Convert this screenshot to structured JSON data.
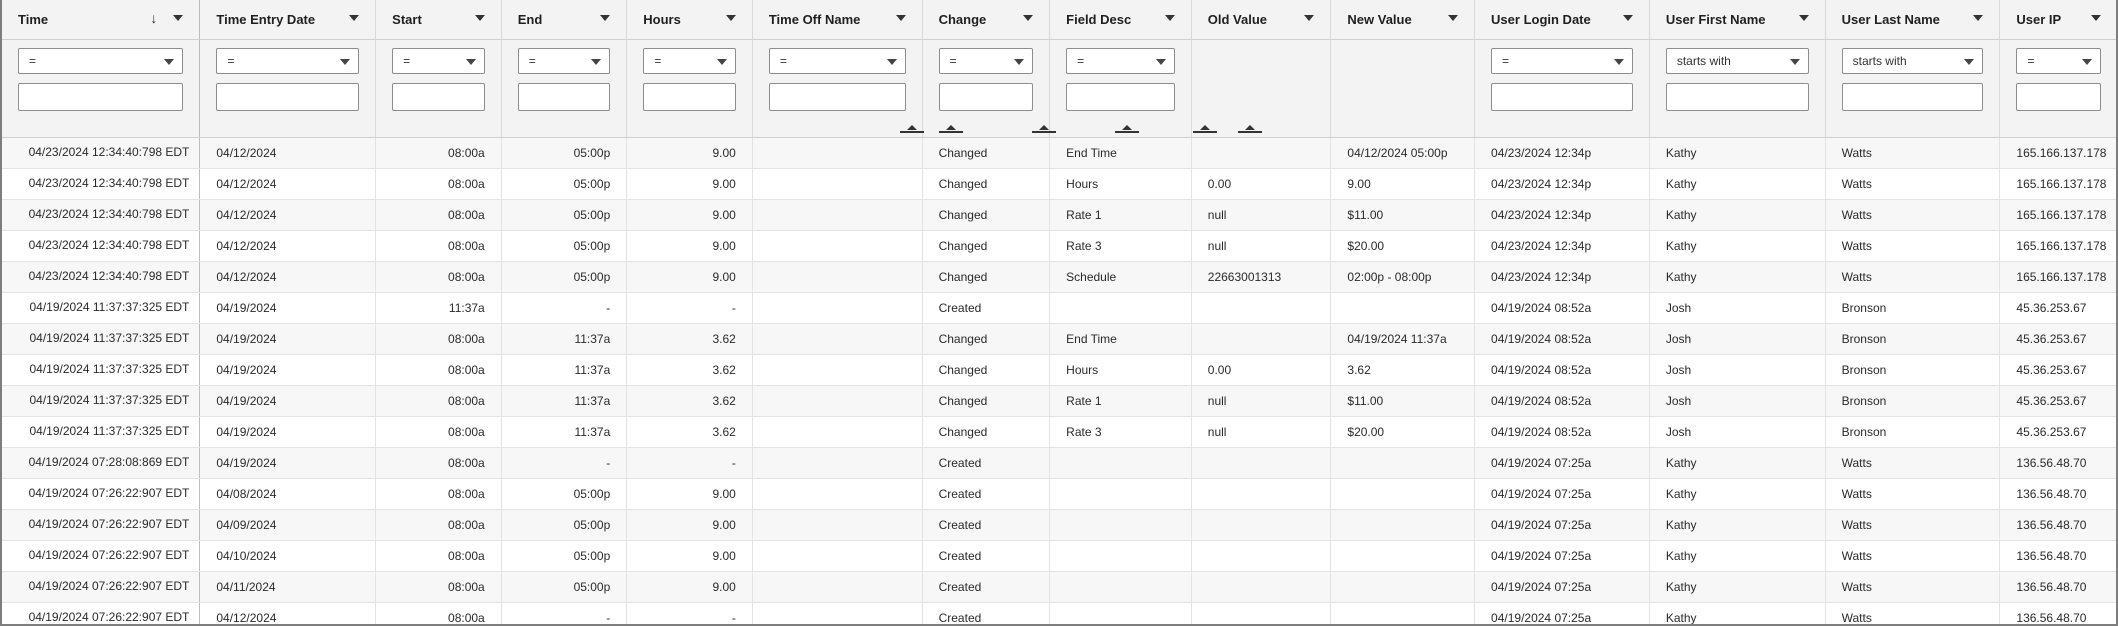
{
  "columns": [
    {
      "label": "Time",
      "sort": "↓"
    },
    {
      "label": "Time Entry Date"
    },
    {
      "label": "Start"
    },
    {
      "label": "End"
    },
    {
      "label": "Hours"
    },
    {
      "label": "Time Off Name"
    },
    {
      "label": "Change"
    },
    {
      "label": "Field Desc"
    },
    {
      "label": "Old Value"
    },
    {
      "label": "New Value"
    },
    {
      "label": "User Login Date"
    },
    {
      "label": "User First Name"
    },
    {
      "label": "User Last Name"
    },
    {
      "label": "User IP"
    }
  ],
  "filters": [
    {
      "op": "=",
      "value": ""
    },
    {
      "op": "=",
      "value": ""
    },
    {
      "op": "=",
      "value": ""
    },
    {
      "op": "=",
      "value": ""
    },
    {
      "op": "=",
      "value": ""
    },
    {
      "op": "=",
      "value": ""
    },
    {
      "op": "=",
      "value": ""
    },
    {
      "op": "=",
      "value": ""
    },
    null,
    null,
    {
      "op": "=",
      "value": ""
    },
    {
      "op": "starts with",
      "value": ""
    },
    {
      "op": "starts with",
      "value": ""
    },
    {
      "op": "=",
      "value": ""
    }
  ],
  "rows": [
    [
      "04/23/2024 12:34:40:798 EDT",
      "04/12/2024",
      "08:00a",
      "05:00p",
      "9.00",
      "",
      "Changed",
      "End Time",
      "",
      "04/12/2024 05:00p",
      "04/23/2024 12:34p",
      "Kathy",
      "Watts",
      "165.166.137.178"
    ],
    [
      "04/23/2024 12:34:40:798 EDT",
      "04/12/2024",
      "08:00a",
      "05:00p",
      "9.00",
      "",
      "Changed",
      "Hours",
      "0.00",
      "9.00",
      "04/23/2024 12:34p",
      "Kathy",
      "Watts",
      "165.166.137.178"
    ],
    [
      "04/23/2024 12:34:40:798 EDT",
      "04/12/2024",
      "08:00a",
      "05:00p",
      "9.00",
      "",
      "Changed",
      "Rate 1",
      "null",
      "$11.00",
      "04/23/2024 12:34p",
      "Kathy",
      "Watts",
      "165.166.137.178"
    ],
    [
      "04/23/2024 12:34:40:798 EDT",
      "04/12/2024",
      "08:00a",
      "05:00p",
      "9.00",
      "",
      "Changed",
      "Rate 3",
      "null",
      "$20.00",
      "04/23/2024 12:34p",
      "Kathy",
      "Watts",
      "165.166.137.178"
    ],
    [
      "04/23/2024 12:34:40:798 EDT",
      "04/12/2024",
      "08:00a",
      "05:00p",
      "9.00",
      "",
      "Changed",
      "Schedule",
      "22663001313",
      "02:00p - 08:00p",
      "04/23/2024 12:34p",
      "Kathy",
      "Watts",
      "165.166.137.178"
    ],
    [
      "04/19/2024 11:37:37:325 EDT",
      "04/19/2024",
      "11:37a",
      "-",
      "-",
      "",
      "Created",
      "",
      "",
      "",
      "04/19/2024 08:52a",
      "Josh",
      "Bronson",
      "45.36.253.67"
    ],
    [
      "04/19/2024 11:37:37:325 EDT",
      "04/19/2024",
      "08:00a",
      "11:37a",
      "3.62",
      "",
      "Changed",
      "End Time",
      "",
      "04/19/2024 11:37a",
      "04/19/2024 08:52a",
      "Josh",
      "Bronson",
      "45.36.253.67"
    ],
    [
      "04/19/2024 11:37:37:325 EDT",
      "04/19/2024",
      "08:00a",
      "11:37a",
      "3.62",
      "",
      "Changed",
      "Hours",
      "0.00",
      "3.62",
      "04/19/2024 08:52a",
      "Josh",
      "Bronson",
      "45.36.253.67"
    ],
    [
      "04/19/2024 11:37:37:325 EDT",
      "04/19/2024",
      "08:00a",
      "11:37a",
      "3.62",
      "",
      "Changed",
      "Rate 1",
      "null",
      "$11.00",
      "04/19/2024 08:52a",
      "Josh",
      "Bronson",
      "45.36.253.67"
    ],
    [
      "04/19/2024 11:37:37:325 EDT",
      "04/19/2024",
      "08:00a",
      "11:37a",
      "3.62",
      "",
      "Changed",
      "Rate 3",
      "null",
      "$20.00",
      "04/19/2024 08:52a",
      "Josh",
      "Bronson",
      "45.36.253.67"
    ],
    [
      "04/19/2024 07:28:08:869 EDT",
      "04/19/2024",
      "08:00a",
      "-",
      "-",
      "",
      "Created",
      "",
      "",
      "",
      "04/19/2024 07:25a",
      "Kathy",
      "Watts",
      "136.56.48.70"
    ],
    [
      "04/19/2024 07:26:22:907 EDT",
      "04/08/2024",
      "08:00a",
      "05:00p",
      "9.00",
      "",
      "Created",
      "",
      "",
      "",
      "04/19/2024 07:25a",
      "Kathy",
      "Watts",
      "136.56.48.70"
    ],
    [
      "04/19/2024 07:26:22:907 EDT",
      "04/09/2024",
      "08:00a",
      "05:00p",
      "9.00",
      "",
      "Created",
      "",
      "",
      "",
      "04/19/2024 07:25a",
      "Kathy",
      "Watts",
      "136.56.48.70"
    ],
    [
      "04/19/2024 07:26:22:907 EDT",
      "04/10/2024",
      "08:00a",
      "05:00p",
      "9.00",
      "",
      "Created",
      "",
      "",
      "",
      "04/19/2024 07:25a",
      "Kathy",
      "Watts",
      "136.56.48.70"
    ],
    [
      "04/19/2024 07:26:22:907 EDT",
      "04/11/2024",
      "08:00a",
      "05:00p",
      "9.00",
      "",
      "Created",
      "",
      "",
      "",
      "04/19/2024 07:25a",
      "Kathy",
      "Watts",
      "136.56.48.70"
    ],
    [
      "04/19/2024 07:26:22:907 EDT",
      "04/12/2024",
      "08:00a",
      "-",
      "-",
      "",
      "Created",
      "",
      "",
      "",
      "04/19/2024 07:25a",
      "Kathy",
      "Watts",
      "136.56.48.70"
    ]
  ]
}
